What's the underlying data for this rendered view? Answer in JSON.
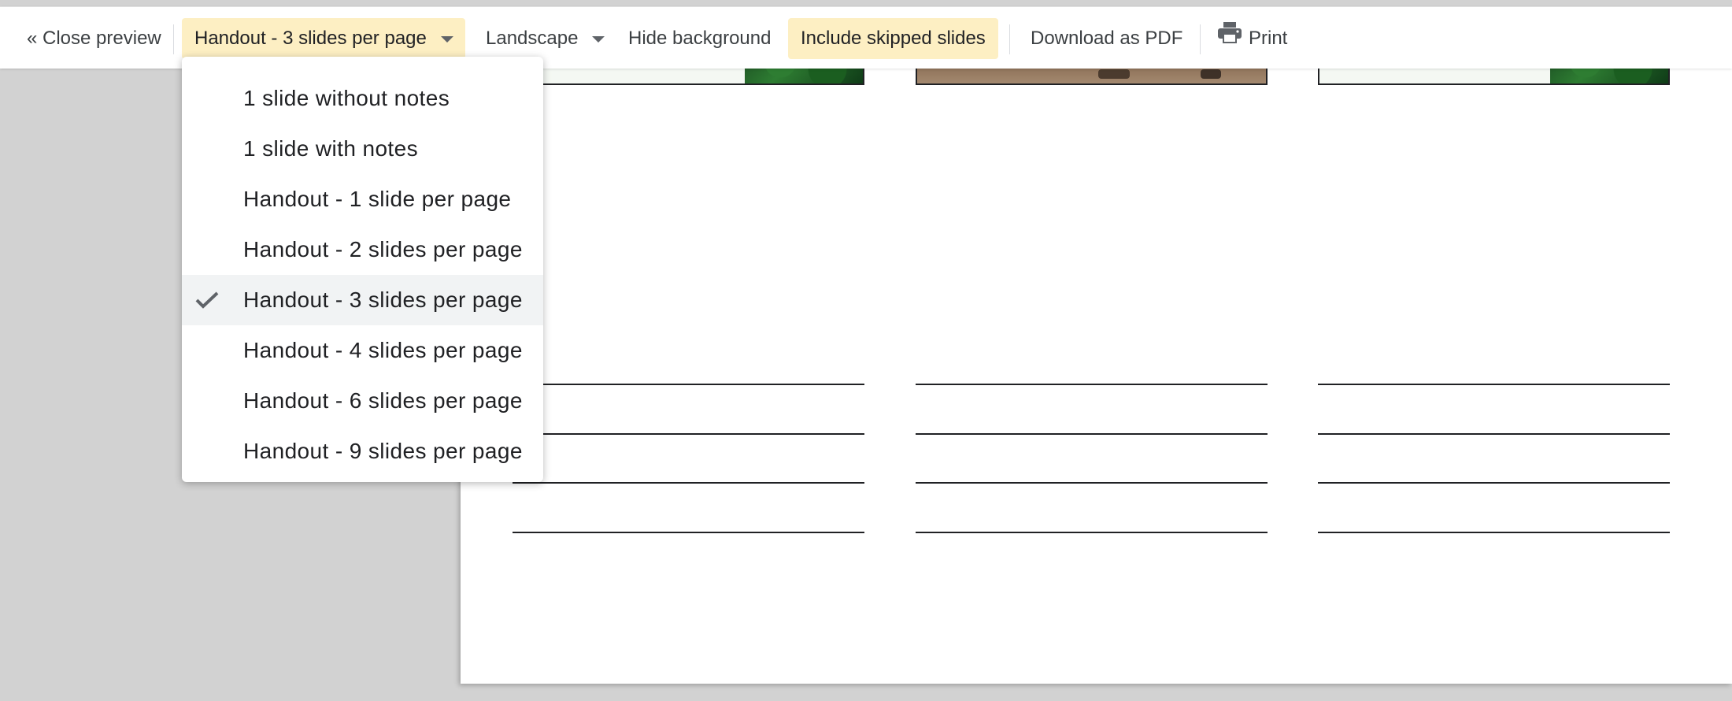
{
  "toolbar": {
    "close_preview": "« Close preview",
    "layout_select": "Handout - 3 slides per page",
    "orientation_select": "Landscape",
    "hide_background": "Hide background",
    "include_skipped": "Include skipped slides",
    "download_pdf": "Download as PDF",
    "print": "Print",
    "active_color": "#fdefc3"
  },
  "menu": {
    "items": [
      {
        "label": "1 slide without notes"
      },
      {
        "label": "1 slide with notes"
      },
      {
        "label": "Handout - 1 slide per page"
      },
      {
        "label": "Handout - 2 slides per page"
      },
      {
        "label": "Handout - 3 slides per page",
        "selected": true
      },
      {
        "label": "Handout - 4 slides per page"
      },
      {
        "label": "Handout - 6 slides per page"
      },
      {
        "label": "Handout - 9 slides per page"
      }
    ]
  },
  "icons": {
    "print": "printer-icon",
    "check": "check-icon",
    "caret": "chevron-down-icon"
  },
  "colors": {
    "page_background": "#d2d2d2",
    "menu_selected": "#f1f3f4"
  }
}
